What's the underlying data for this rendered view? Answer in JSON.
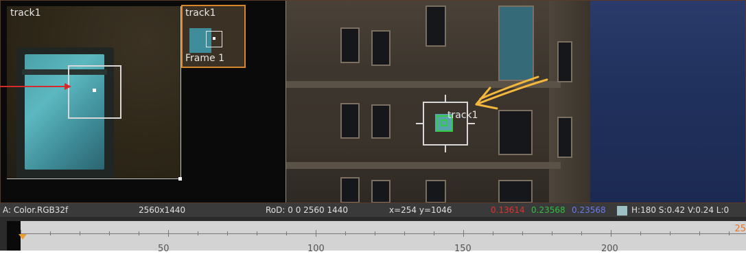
{
  "viewer": {
    "inset_label": "track1",
    "thumbnail_label": "track1",
    "thumbnail_frame": "Frame 1",
    "tracker_label": "track1"
  },
  "infobar": {
    "channels": "A: Color.RGB32f",
    "resolution": "2560x1440",
    "rod": "RoD: 0 0 2560 1440",
    "coords": "x=254 y=1046",
    "pixel_r": "0.13614",
    "pixel_g": "0.23568",
    "pixel_b": "0.23568",
    "hsv": "H:180 S:0.42 V:0.24 L:0"
  },
  "timeline": {
    "current_frame": "25",
    "tick_labels": [
      "50",
      "100",
      "150",
      "200"
    ]
  },
  "colors": {
    "pixel_r": "#e0302a",
    "pixel_g": "#30c040",
    "pixel_b": "#5a6ae0",
    "annotation_red": "#d42a2a",
    "annotation_yellow": "#f2b73c",
    "thumbnail_border": "#d7872a"
  }
}
